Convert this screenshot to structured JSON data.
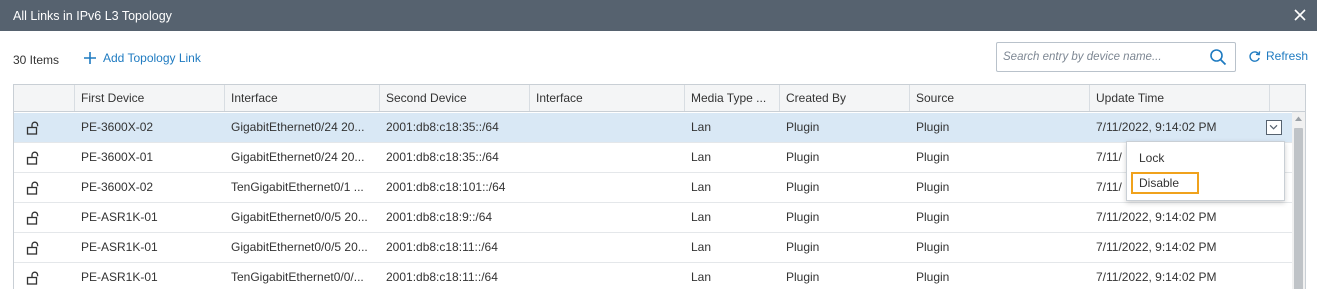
{
  "dialog": {
    "title": "All Links in IPv6 L3 Topology"
  },
  "toolbar": {
    "count": "30 Items",
    "add_label": "Add Topology Link",
    "search_placeholder": "Search entry by device name...",
    "refresh_label": "Refresh"
  },
  "columns": [
    "",
    "First Device",
    "Interface",
    "Second Device",
    "Interface",
    "Media Type ...",
    "Created By",
    "Source",
    "Update Time"
  ],
  "rows": [
    {
      "first": "PE-3600X-02",
      "iface1": "GigabitEthernet0/24 20...",
      "second": "2001:db8:c18:35::/64",
      "iface2": "",
      "media": "Lan",
      "created": "Plugin",
      "source": "Plugin",
      "updated": "7/11/2022, 9:14:02 PM"
    },
    {
      "first": "PE-3600X-01",
      "iface1": "GigabitEthernet0/24 20...",
      "second": "2001:db8:c18:35::/64",
      "iface2": "",
      "media": "Lan",
      "created": "Plugin",
      "source": "Plugin",
      "updated": "7/11/"
    },
    {
      "first": "PE-3600X-02",
      "iface1": "TenGigabitEthernet0/1 ...",
      "second": "2001:db8:c18:101::/64",
      "iface2": "",
      "media": "Lan",
      "created": "Plugin",
      "source": "Plugin",
      "updated": "7/11/"
    },
    {
      "first": "PE-ASR1K-01",
      "iface1": "GigabitEthernet0/0/5 20...",
      "second": "2001:db8:c18:9::/64",
      "iface2": "",
      "media": "Lan",
      "created": "Plugin",
      "source": "Plugin",
      "updated": "7/11/2022, 9:14:02 PM"
    },
    {
      "first": "PE-ASR1K-01",
      "iface1": "GigabitEthernet0/0/5 20...",
      "second": "2001:db8:c18:11::/64",
      "iface2": "",
      "media": "Lan",
      "created": "Plugin",
      "source": "Plugin",
      "updated": "7/11/2022, 9:14:02 PM"
    },
    {
      "first": "PE-ASR1K-01",
      "iface1": "TenGigabitEthernet0/0/...",
      "second": "2001:db8:c18:11::/64",
      "iface2": "",
      "media": "Lan",
      "created": "Plugin",
      "source": "Plugin",
      "updated": "7/11/2022, 9:14:02 PM"
    }
  ],
  "context_menu": {
    "lock": "Lock",
    "disable": "Disable"
  },
  "colors": {
    "titlebar": "#56626f",
    "link": "#1f7bc1",
    "selected_row": "#d9e8f5",
    "focus_outline": "#f0a21c"
  },
  "icons": {
    "close": "close-icon",
    "add": "plus-icon",
    "search": "search-icon",
    "refresh": "refresh-icon",
    "row_lock": "unlock-icon",
    "row_menu": "chevron-down-icon"
  }
}
